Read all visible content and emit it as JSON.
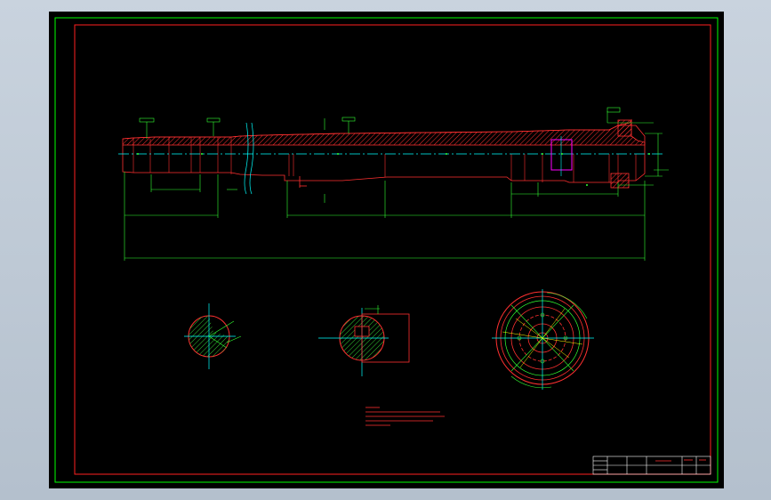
{
  "colors": {
    "background": "#000000",
    "outer_frame": "#00ff00",
    "inner_frame": "#ff2020",
    "center_line": "#00ffff",
    "dimension": "#33ff33",
    "outline": "#ff3030",
    "highlight": "#ff00ff",
    "hatch": "#ff3030"
  },
  "title_block": {
    "label_left": "",
    "label_mid": "",
    "label_right": ""
  },
  "notes": {
    "heading": "",
    "lines": []
  }
}
